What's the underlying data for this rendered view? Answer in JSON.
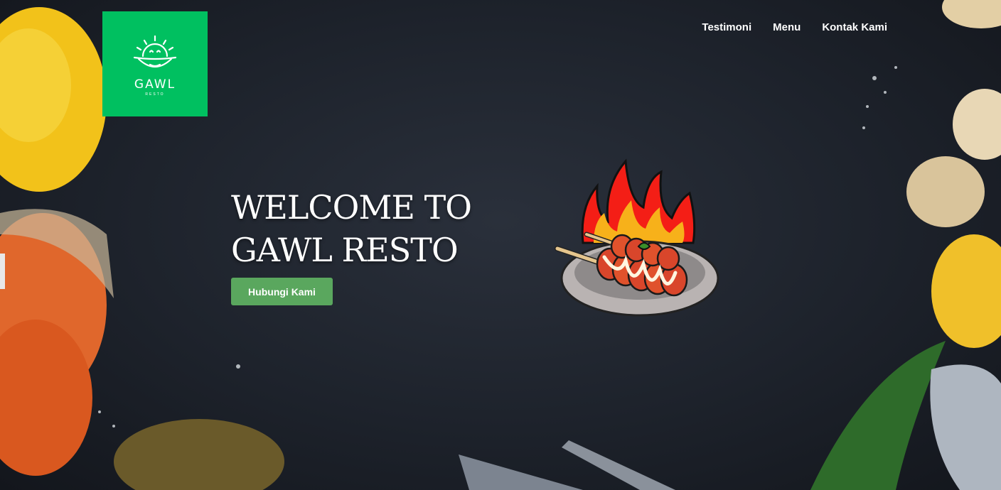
{
  "logo": {
    "name": "GAWL",
    "sub": "RESTO"
  },
  "nav": {
    "items": [
      "Testimoni",
      "Menu",
      "Kontak Kami"
    ]
  },
  "hero": {
    "title_line1": "WELCOME TO",
    "title_line2": "GAWL RESTO",
    "cta_label": "Hubungi Kami"
  },
  "colors": {
    "brand": "#00c060",
    "cta": "#5aa75e",
    "background": "#1b1f27"
  },
  "illustration": {
    "icon": "grilled-skewer-fire-icon"
  }
}
